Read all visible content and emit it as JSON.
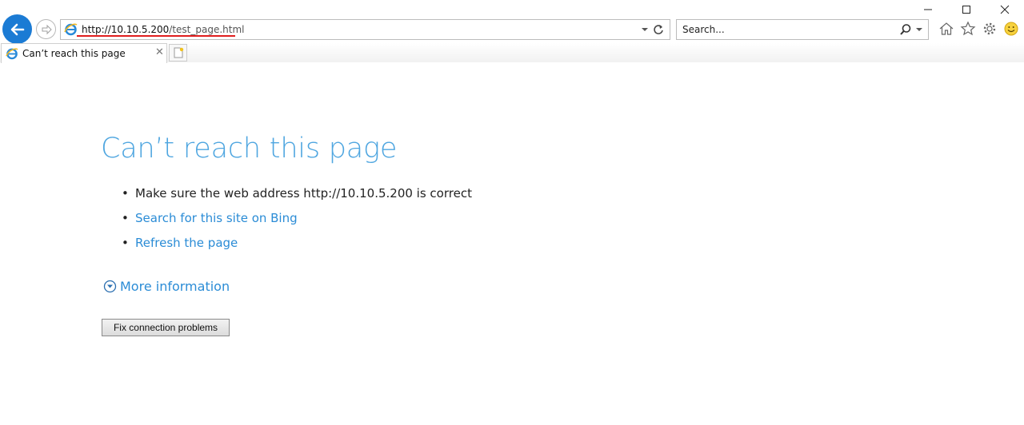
{
  "window": {
    "minimize_glyph": "—",
    "maximize_glyph": "☐",
    "close_glyph": "✕"
  },
  "toolbar": {
    "url_host": "http://10.10.5.200",
    "url_path": "/test_page.html",
    "search_placeholder": "Search...",
    "icons": [
      "back-arrow-icon",
      "forward-arrow-icon",
      "ie-icon",
      "dropdown-icon",
      "refresh-icon",
      "search-icon",
      "home-icon",
      "favorites-star-icon",
      "settings-gear-icon",
      "smiley-feedback-icon"
    ]
  },
  "tabs": [
    {
      "title": "Can’t reach this page",
      "close": "✕"
    }
  ],
  "page": {
    "heading": "Can’t reach this page",
    "tip_1": "Make sure the web address http://10.10.5.200 is correct",
    "tip_2": "Search for this site on Bing",
    "tip_3": "Refresh the page",
    "more_info": "More information",
    "fix_button": "Fix connection problems"
  },
  "colors": {
    "accent": "#1b7bd4",
    "heading": "#4fa6e0",
    "link": "#2b8cd6",
    "url_underline": "#e01e1e"
  }
}
